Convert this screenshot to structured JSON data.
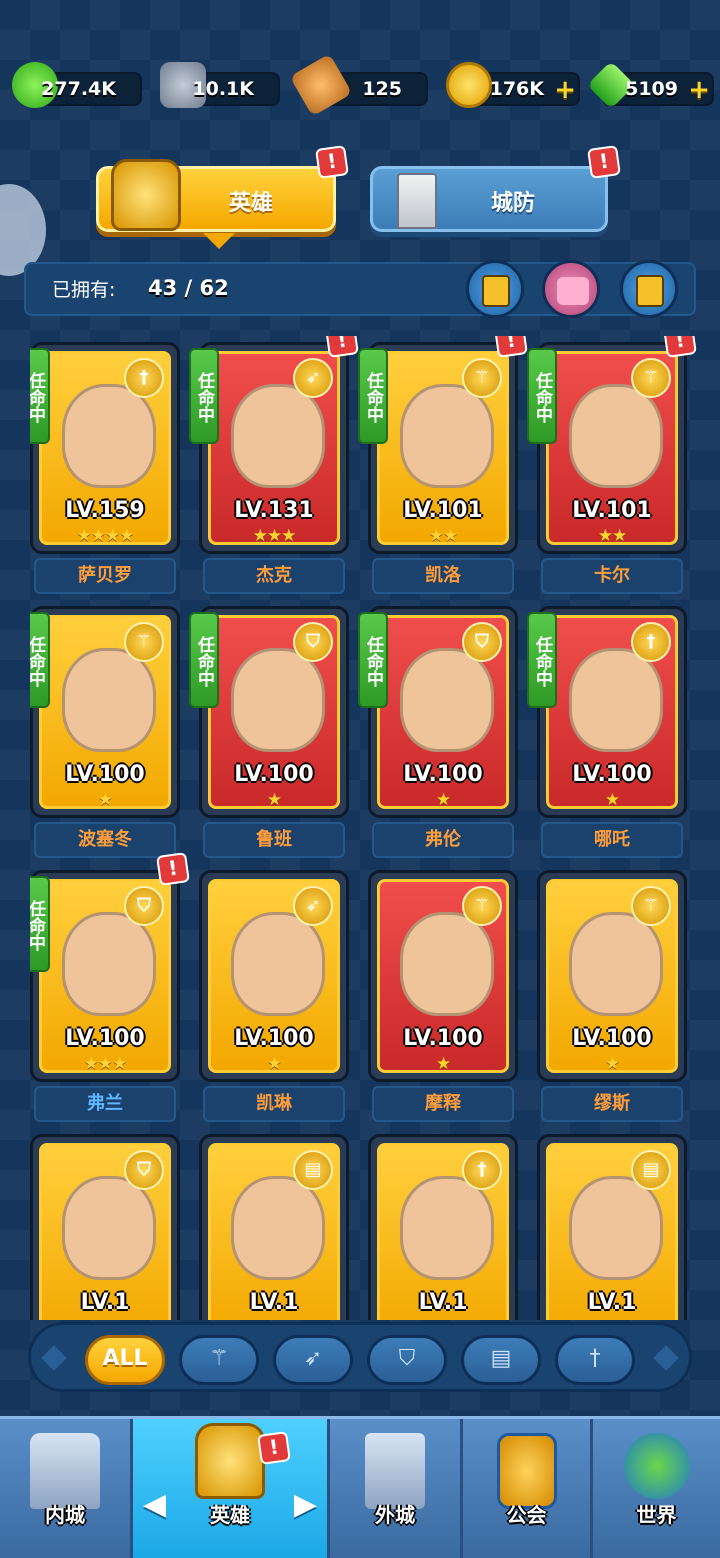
{
  "resources": [
    {
      "icon": "green-crystal-icon",
      "value": "277.4K",
      "plus": false
    },
    {
      "icon": "stone-tablet-icon",
      "value": "10.1K",
      "plus": false
    },
    {
      "icon": "hammer-icon",
      "value": "125",
      "plus": false
    },
    {
      "icon": "gold-coin-icon",
      "value": "176K",
      "plus": true
    },
    {
      "icon": "green-gem-icon",
      "value": "5109",
      "plus": true
    }
  ],
  "tabs": {
    "hero_label": "英雄",
    "defense_label": "城防",
    "alert_mark": "!"
  },
  "owned": {
    "label": "已拥有:",
    "count": "43 / 62"
  },
  "mission_tag": "任命中",
  "heroes": [
    {
      "name": "萨贝罗",
      "level": "LV.159",
      "stars": "★★★★",
      "bg": "gold",
      "mission": true,
      "alert": false,
      "class_icon": "sword-icon",
      "name_color": "orange"
    },
    {
      "name": "杰克",
      "level": "LV.131",
      "stars": "★★★",
      "bg": "red",
      "mission": true,
      "alert": true,
      "class_icon": "bow-icon",
      "name_color": "orange"
    },
    {
      "name": "凯洛",
      "level": "LV.101",
      "stars": "★★",
      "bg": "gold",
      "mission": true,
      "alert": true,
      "class_icon": "staff-icon",
      "name_color": "orange"
    },
    {
      "name": "卡尔",
      "level": "LV.101",
      "stars": "★★",
      "bg": "red",
      "mission": true,
      "alert": true,
      "class_icon": "staff-icon",
      "name_color": "orange"
    },
    {
      "name": "波塞冬",
      "level": "LV.100",
      "stars": "★",
      "bg": "gold",
      "mission": true,
      "alert": false,
      "class_icon": "staff-icon",
      "name_color": "orange"
    },
    {
      "name": "鲁班",
      "level": "LV.100",
      "stars": "★",
      "bg": "red",
      "mission": true,
      "alert": false,
      "class_icon": "shield-icon",
      "name_color": "orange"
    },
    {
      "name": "弗伦",
      "level": "LV.100",
      "stars": "★",
      "bg": "red",
      "mission": true,
      "alert": false,
      "class_icon": "shield-icon",
      "name_color": "orange"
    },
    {
      "name": "哪吒",
      "level": "LV.100",
      "stars": "★",
      "bg": "red",
      "mission": true,
      "alert": false,
      "class_icon": "sword-icon",
      "name_color": "orange"
    },
    {
      "name": "弗兰",
      "level": "LV.100",
      "stars": "★★★",
      "bg": "gold",
      "mission": true,
      "alert": true,
      "class_icon": "shield-icon",
      "name_color": "blue"
    },
    {
      "name": "凯琳",
      "level": "LV.100",
      "stars": "★",
      "bg": "gold",
      "mission": false,
      "alert": false,
      "class_icon": "bow-icon",
      "name_color": "orange"
    },
    {
      "name": "摩释",
      "level": "LV.100",
      "stars": "★",
      "bg": "red",
      "mission": false,
      "alert": false,
      "class_icon": "staff-icon",
      "name_color": "orange"
    },
    {
      "name": "缪斯",
      "level": "LV.100",
      "stars": "★",
      "bg": "gold",
      "mission": false,
      "alert": false,
      "class_icon": "staff-icon",
      "name_color": "orange"
    },
    {
      "name": "",
      "level": "LV.1",
      "stars": "★",
      "bg": "gold",
      "mission": false,
      "alert": false,
      "class_icon": "shield-icon",
      "name_color": "orange"
    },
    {
      "name": "",
      "level": "LV.1",
      "stars": "★",
      "bg": "gold",
      "mission": false,
      "alert": false,
      "class_icon": "book-icon",
      "name_color": "orange"
    },
    {
      "name": "",
      "level": "LV.1",
      "stars": "★",
      "bg": "gold",
      "mission": false,
      "alert": false,
      "class_icon": "sword-icon",
      "name_color": "orange"
    },
    {
      "name": "",
      "level": "LV.1",
      "stars": "★",
      "bg": "gold",
      "mission": false,
      "alert": false,
      "class_icon": "book-icon",
      "name_color": "orange"
    }
  ],
  "filters": [
    {
      "label": "ALL",
      "icon": "all-filter",
      "active": true
    },
    {
      "label": "",
      "icon": "staff-icon",
      "active": false
    },
    {
      "label": "",
      "icon": "bow-icon",
      "active": false
    },
    {
      "label": "",
      "icon": "shield-icon",
      "active": false
    },
    {
      "label": "",
      "icon": "book-icon",
      "active": false
    },
    {
      "label": "",
      "icon": "sword-icon",
      "active": false
    }
  ],
  "bottom_nav": [
    {
      "label": "内城",
      "icon": "castle-icon",
      "active": false
    },
    {
      "label": "英雄",
      "icon": "helmet-icon",
      "active": true
    },
    {
      "label": "外城",
      "icon": "tower-icon",
      "active": false
    },
    {
      "label": "公会",
      "icon": "handshake-icon",
      "active": false
    },
    {
      "label": "世界",
      "icon": "globe-icon",
      "active": false
    }
  ],
  "colors": {
    "accent_gold": "#f5a800",
    "mission_green": "#2e9a26",
    "alert_red": "#e23a3a",
    "name_orange": "#ff9d3a",
    "name_blue": "#5fb6ff"
  }
}
